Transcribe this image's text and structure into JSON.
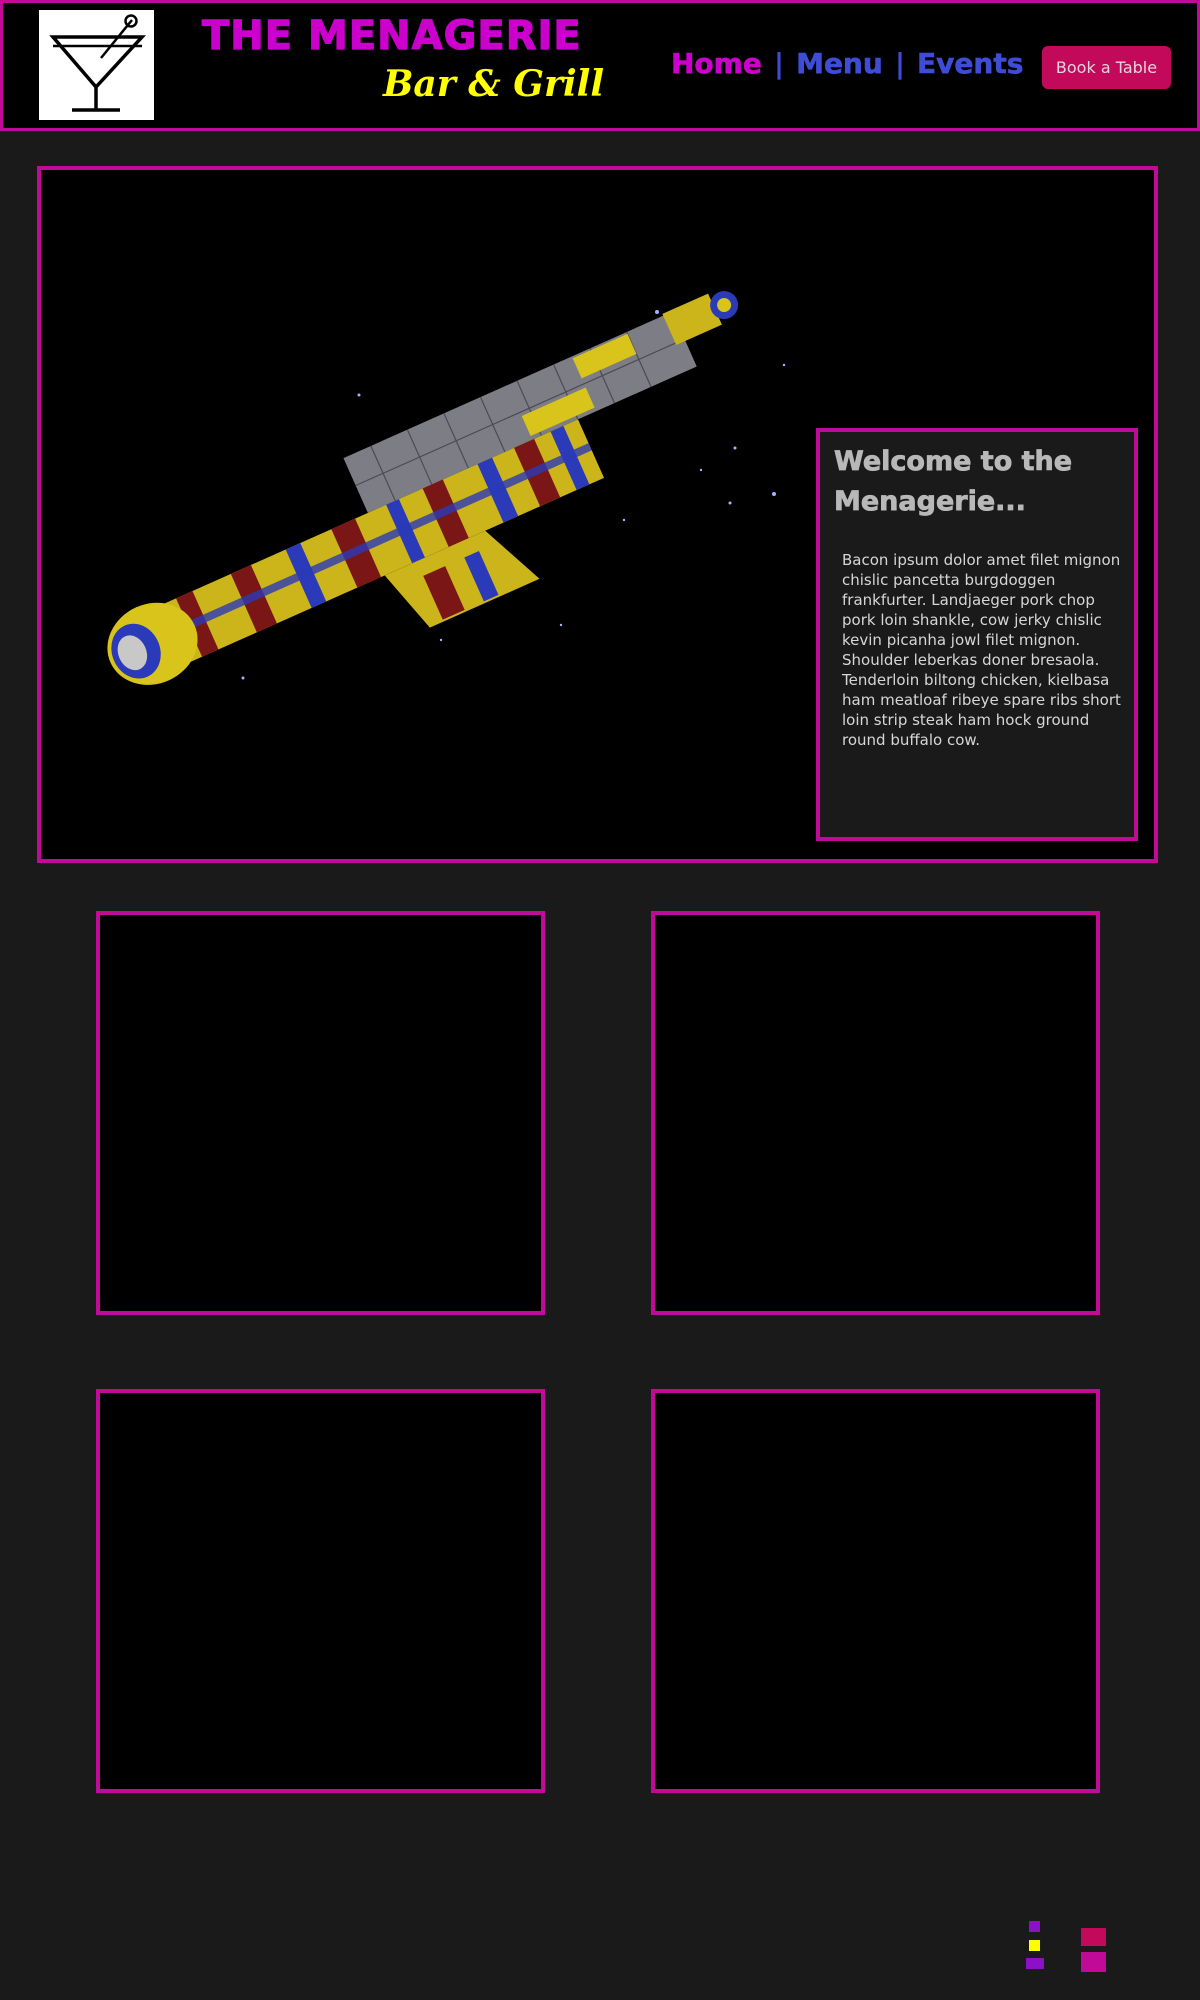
{
  "header": {
    "logo_icon": "martini-glass-icon",
    "brand_title": "THE MENAGERIE",
    "brand_subtitle": "Bar & Grill",
    "nav": {
      "home": "Home",
      "menu": "Menu",
      "events": "Events",
      "separator": "|"
    },
    "book_button": "Book a Table"
  },
  "hero": {
    "image_icon": "spaceship-image",
    "welcome_title": "Welcome to the Menagerie...",
    "welcome_body": "Bacon ipsum dolor amet filet mignon chislic pancetta burgdoggen frankfurter. Landjaeger pork chop pork loin shankle, cow jerky chislic kevin picanha jowl filet mignon. Shoulder leberkas doner bresaola. Tenderloin biltong chicken, kielbasa ham meatloaf ribeye spare ribs short loin strip steak ham hock ground round buffalo cow."
  },
  "colors": {
    "background": "#1a1a1a",
    "border_accent": "#c20a99",
    "title_magenta": "#cc00cc",
    "subtitle_yellow": "#ffff00",
    "nav_blue": "#3f4dd6",
    "button_bg": "#c2095a"
  }
}
